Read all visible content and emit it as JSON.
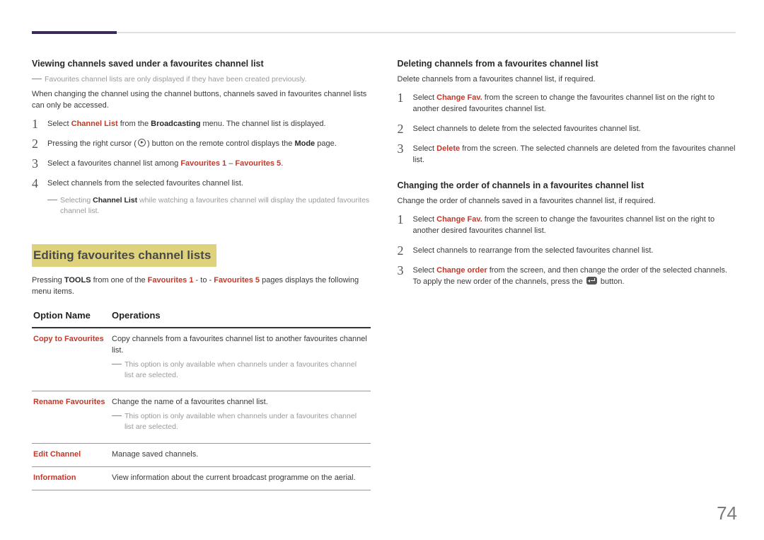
{
  "page_number": "74",
  "left": {
    "h_viewing": "Viewing channels saved under a favourites channel list",
    "note1": "Favourites channel lists are only displayed if they have been created previously.",
    "para1": "When changing the channel using the channel buttons, channels saved in favourites channel lists can only be accessed.",
    "steps_view": [
      {
        "pre": "Select ",
        "red1": "Channel List",
        "mid": " from the ",
        "bold1": "Broadcasting",
        "post": " menu. The channel list is displayed."
      },
      {
        "pre": "Pressing the right cursor (",
        "icon": "play",
        "mid2": ") button on the remote control displays the ",
        "bold1": "Mode",
        "post": " page."
      },
      {
        "pre": "Select a favourites channel list among ",
        "red1": "Favourites 1",
        "mid": " – ",
        "red2": "Favourites 5",
        "post": "."
      },
      {
        "pre": "Select channels from the selected favourites channel list."
      }
    ],
    "note2a": "Selecting ",
    "note2b": "Channel List",
    "note2c": " while watching a favourites channel will display the updated favourites channel list.",
    "h_editing": "Editing favourites channel lists",
    "para2_pre": "Pressing ",
    "para2_tools": "TOOLS",
    "para2_mid": " from one of the ",
    "para2_f1": "Favourites 1",
    "para2_sep": " - to - ",
    "para2_f5": "Favourites 5",
    "para2_post": " pages displays the following menu items.",
    "table": {
      "col_option": "Option Name",
      "col_ops": "Operations",
      "rows": [
        {
          "name": "Copy to Favourites",
          "text": "Copy channels from a favourites channel list to another favourites channel list.",
          "note": "This option is only available when channels under a favourites channel list are selected."
        },
        {
          "name": "Rename Favourites",
          "text": "Change the name of a favourites channel list.",
          "note": "This option is only available when channels under a favourites channel list are selected."
        },
        {
          "name": "Edit Channel",
          "text": "Manage saved channels."
        },
        {
          "name": "Information",
          "text": "View information about the current broadcast programme on the aerial."
        }
      ]
    }
  },
  "right": {
    "h_deleting": "Deleting channels from a favourites channel list",
    "para_del": "Delete channels from a favourites channel list, if required.",
    "steps_del": [
      {
        "pre": "Select ",
        "red1": "Change Fav.",
        "post": " from the screen to change the favourites channel list on the right to another desired favourites channel list."
      },
      {
        "pre": "Select channels to delete from the selected favourites channel list."
      },
      {
        "pre": "Select ",
        "red1": "Delete",
        "post": " from the screen. The selected channels are deleted from the favourites channel list."
      }
    ],
    "h_order": "Changing the order of channels in a favourites channel list",
    "para_order": "Change the order of channels saved in a favourites channel list, if required.",
    "steps_order": [
      {
        "pre": "Select ",
        "red1": "Change Fav.",
        "post": " from the screen to change the favourites channel list on the right to another desired favourites channel list."
      },
      {
        "pre": "Select channels to rearrange from the selected favourites channel list."
      },
      {
        "pre": "Select ",
        "red1": "Change order",
        "mid": " from the screen, and then change the order of the selected channels. To apply the new order of the channels, press the ",
        "icon": "enter",
        "post": " button."
      }
    ]
  }
}
